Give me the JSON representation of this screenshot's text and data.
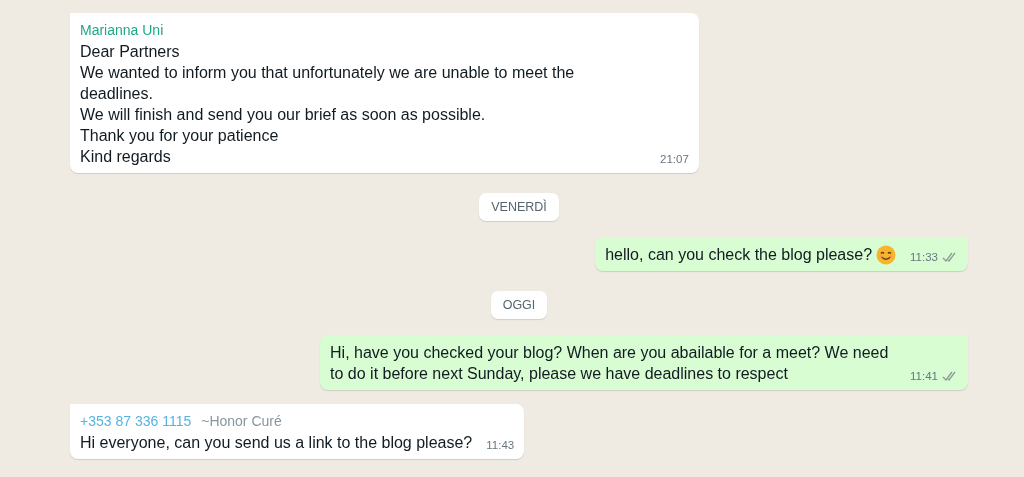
{
  "messages": [
    {
      "kind": "incoming",
      "sender": "Marianna Uni",
      "color": "#1fa885",
      "lines": [
        "Dear Partners",
        "We wanted to inform you that unfortunately we are unable to meet the deadlines.",
        "We will finish and send you our brief as soon as possible.",
        "Thank you for your patience",
        "Kind regards"
      ],
      "time": "21:07"
    },
    {
      "kind": "date",
      "label": "VENERDÌ"
    },
    {
      "kind": "outgoing",
      "lines": [
        "hello, can you check the blog please?"
      ],
      "emoji": true,
      "time": "11:33",
      "read": false
    },
    {
      "kind": "date",
      "label": "OGGI"
    },
    {
      "kind": "outgoing",
      "lines": [
        "Hi, have you checked your blog? When are you abailable for a meet? We need to do it before next Sunday, please we have deadlines to respect"
      ],
      "emoji": false,
      "time": "11:41",
      "read": false
    },
    {
      "kind": "incoming",
      "sender": "+353 87 336 1115",
      "color": "#53b4e0",
      "push_name": "~Honor Curé",
      "lines": [
        "Hi everyone, can you send us a link to the blog please?"
      ],
      "time": "11:43"
    }
  ]
}
